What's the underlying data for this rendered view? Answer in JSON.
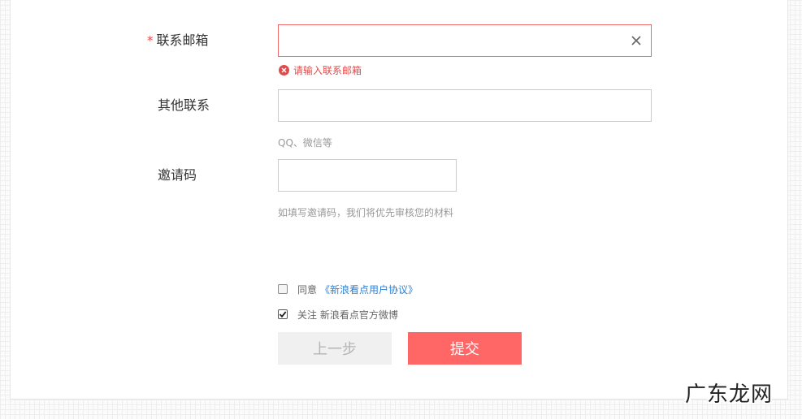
{
  "form": {
    "email": {
      "label": "联系邮箱",
      "required_mark": "*",
      "value": "",
      "error": "请输入联系邮箱"
    },
    "other_contact": {
      "label": "其他联系",
      "value": "",
      "hint": "QQ、微信等"
    },
    "invite_code": {
      "label": "邀请码",
      "value": "",
      "hint": "如填写邀请码，我们将优先审核您的材料"
    },
    "agree": {
      "checked": false,
      "text": "同意",
      "link_text": "《新浪看点用户协议》"
    },
    "follow": {
      "checked": true,
      "text": "关注 新浪看点官方微博"
    },
    "buttons": {
      "prev_label": "上一步",
      "submit_label": "提交"
    }
  },
  "colors": {
    "accent": "#ff6767",
    "error": "#e24b4b",
    "link": "#2a7fd4"
  },
  "icons": [
    "close-icon",
    "error-icon",
    "check-icon"
  ],
  "watermark": "广东龙网"
}
